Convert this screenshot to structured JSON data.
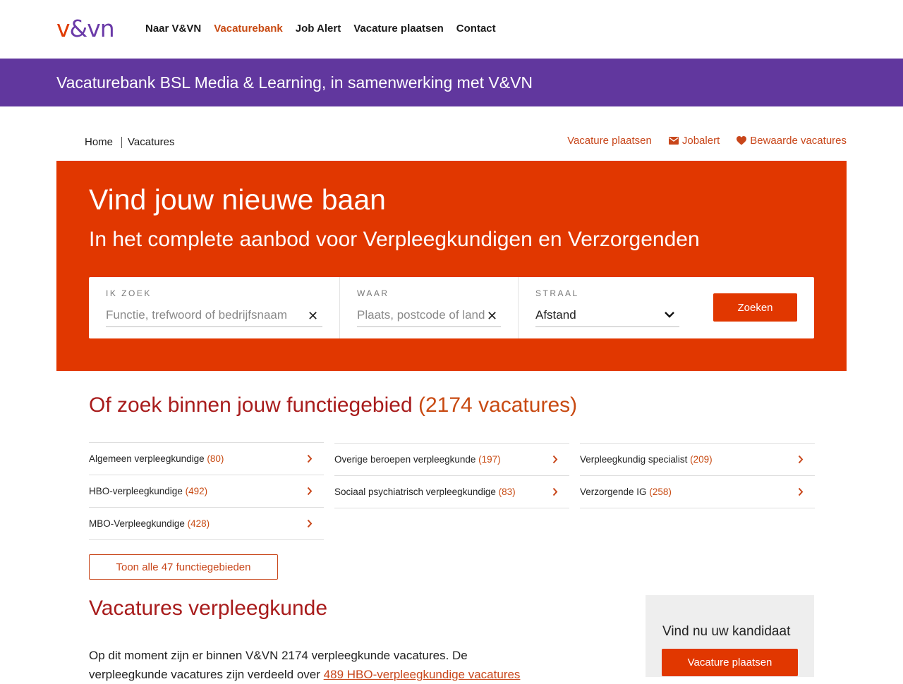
{
  "nav": {
    "logo": {
      "v": "v",
      "amp": "&",
      "vn": "vn"
    },
    "links": [
      "Naar V&VN",
      "Vacaturebank",
      "Job Alert",
      "Vacature plaatsen",
      "Contact"
    ],
    "active_index": 1
  },
  "banner": {
    "title": "Vacaturebank BSL Media & Learning, in samenwerking met V&VN"
  },
  "breadcrumb": [
    "Home",
    "Vacatures"
  ],
  "quicklinks": [
    "Vacature plaatsen",
    "Jobalert",
    "Bewaarde vacatures"
  ],
  "hero": {
    "title": "Vind jouw nieuwe baan",
    "subtitle": "In het complete aanbod voor Verpleegkundigen en Verzorgenden",
    "search": {
      "what_label": "IK ZOEK",
      "what_placeholder": "Functie, trefwoord of bedrijfsnaam",
      "where_label": "WAAR",
      "where_placeholder": "Plaats, postcode of land",
      "radius_label": "STRAAL",
      "radius_value": "Afstand",
      "button": "Zoeken"
    }
  },
  "function_areas": {
    "title": "Of zoek binnen jouw functiegebied",
    "total": "(2174 vacatures)",
    "columns": [
      [
        {
          "label": "Algemeen verpleegkundige",
          "count": "(80)"
        },
        {
          "label": "HBO-verpleegkundige",
          "count": "(492)"
        },
        {
          "label": "MBO-Verpleegkundige",
          "count": "(428)"
        }
      ],
      [
        {
          "label": "Overige beroepen verpleegkunde",
          "count": "(197)"
        },
        {
          "label": "Sociaal psychiatrisch verpleegkundige",
          "count": "(83)"
        }
      ],
      [
        {
          "label": "Verpleegkundig specialist",
          "count": "(209)"
        },
        {
          "label": "Verzorgende IG",
          "count": "(258)"
        }
      ]
    ],
    "show_all": "Toon alle 47 functiegebieden"
  },
  "vacatures": {
    "title": "Vacatures verpleegkunde",
    "text_line1": "Op dit moment zijn er binnen V&VN 2174 verpleegkunde vacatures. De",
    "text_line2": "verpleegkunde vacatures zijn verdeeld over",
    "link": "489 HBO-verpleegkundige vacatures"
  },
  "sidepanel": {
    "title": "Vind nu uw kandidaat",
    "button": "Vacature plaatsen"
  },
  "colors": {
    "brand_orange": "#e13700",
    "brand_purple": "#61379e",
    "heading_red": "#a81c1c",
    "link_orange": "#c8461a"
  }
}
